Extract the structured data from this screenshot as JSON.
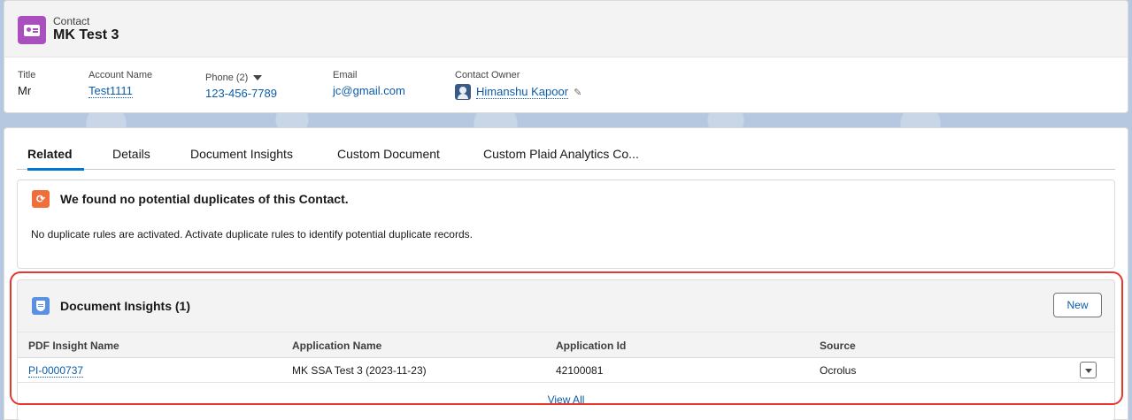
{
  "header": {
    "object_label": "Contact",
    "record_title": "MK Test 3",
    "fields": {
      "title": {
        "label": "Title",
        "value": "Mr"
      },
      "account": {
        "label": "Account Name",
        "value": "Test1111"
      },
      "phone": {
        "label": "Phone (2)",
        "value": "123-456-7789"
      },
      "email": {
        "label": "Email",
        "value": "jc@gmail.com"
      },
      "owner": {
        "label": "Contact Owner",
        "value": "Himanshu Kapoor"
      }
    }
  },
  "tabs": [
    {
      "label": "Related",
      "active": true
    },
    {
      "label": "Details",
      "active": false
    },
    {
      "label": "Document Insights",
      "active": false
    },
    {
      "label": "Custom Document",
      "active": false
    },
    {
      "label": "Custom Plaid Analytics Co...",
      "active": false
    }
  ],
  "duplicates": {
    "title": "We found no potential duplicates of this Contact.",
    "message": "No duplicate rules are activated. Activate duplicate rules to identify potential duplicate records."
  },
  "document_insights": {
    "title": "Document Insights (1)",
    "new_button": "New",
    "columns": [
      "PDF Insight Name",
      "Application Name",
      "Application Id",
      "Source"
    ],
    "rows": [
      {
        "name": "PI-0000737",
        "application_name": "MK SSA Test 3 (2023-11-23)",
        "application_id": "42100081",
        "source": "Ocrolus"
      }
    ],
    "view_all": "View All"
  },
  "colors": {
    "brand_blue": "#0176d3",
    "link": "#0b5cab",
    "contact_icon": "#a94fbe",
    "duplicate_icon": "#ef6e3a",
    "insights_icon": "#5a90e1",
    "highlight": "#e6362d"
  }
}
